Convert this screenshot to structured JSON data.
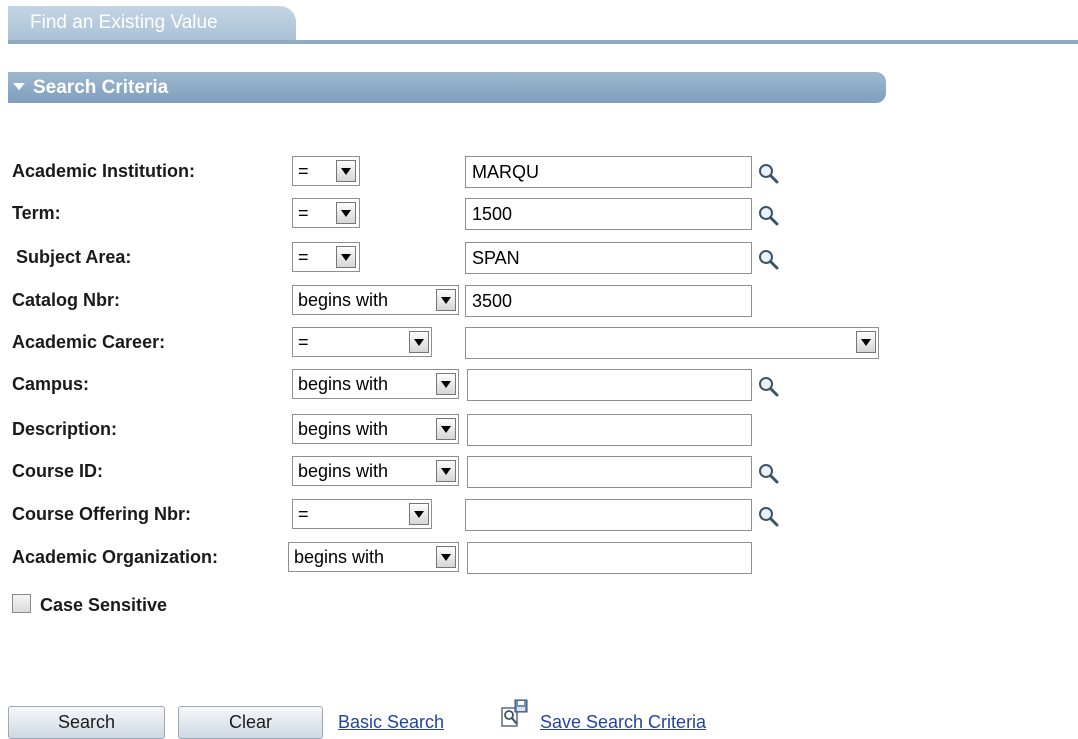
{
  "tab": {
    "label": "Find an Existing Value"
  },
  "section": {
    "title": "Search Criteria"
  },
  "fields": {
    "institution": {
      "label": "Academic Institution:",
      "operator": "=",
      "value": "MARQU"
    },
    "term": {
      "label": "Term:",
      "operator": "=",
      "value": "1500"
    },
    "subject": {
      "label": "Subject Area:",
      "operator": "=",
      "value": "SPAN"
    },
    "catalog": {
      "label": "Catalog Nbr:",
      "operator": "begins with",
      "value": "3500"
    },
    "career": {
      "label": "Academic Career:",
      "operator": "=",
      "value": ""
    },
    "campus": {
      "label": "Campus:",
      "operator": "begins with",
      "value": ""
    },
    "description": {
      "label": "Description:",
      "operator": "begins with",
      "value": ""
    },
    "course_id": {
      "label": "Course ID:",
      "operator": "begins with",
      "value": ""
    },
    "offering": {
      "label": "Course Offering Nbr:",
      "operator": "=",
      "value": ""
    },
    "org": {
      "label": "Academic Organization:",
      "operator": "begins with",
      "value": ""
    }
  },
  "case_sensitive": {
    "label": "Case Sensitive",
    "checked": false
  },
  "buttons": {
    "search": "Search",
    "clear": "Clear"
  },
  "links": {
    "basic_search": "Basic Search",
    "save_criteria": "Save Search Criteria"
  },
  "colors": {
    "tab": "#b4c9dc",
    "header": "#8aa7c2",
    "link": "#22449e"
  },
  "icons": {
    "lookup": "magnifier-icon",
    "dropdown": "chevron-down-icon",
    "save": "save-search-icon"
  }
}
